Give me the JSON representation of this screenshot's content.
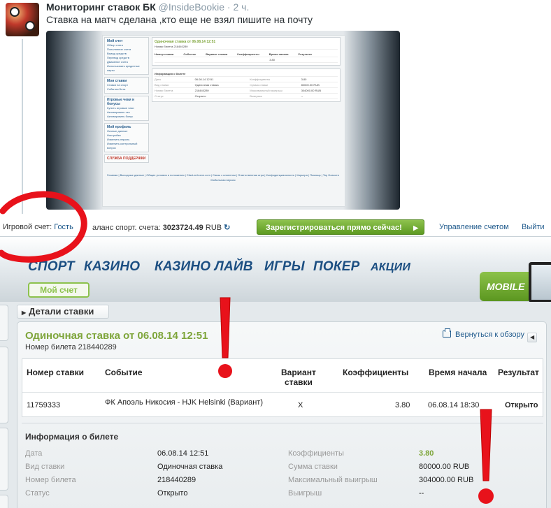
{
  "tweet": {
    "name": "Мониторинг ставок БК",
    "handle": "@InsideBookie",
    "time": "· 2 ч.",
    "text": "Ставка на матч сделана ,кто еще не взял пишите на почту"
  },
  "topbar": {
    "account_label": "Игровой счет:",
    "account_value": "Гость",
    "balance_label": "аланс спорт. счета:",
    "balance_value": "3023724.49",
    "currency": "RUB",
    "register_button": "Зарегистрироваться прямо сейчас!",
    "manage_account": "Управление счетом",
    "logout": "Выйти"
  },
  "nav": {
    "tabs": [
      "СПОРТ",
      "КАЗИНО",
      "КАЗИНО ЛАЙВ",
      "ИГРЫ",
      "ПОКЕР",
      "АКЦИИ"
    ],
    "my_account": "Мой счет",
    "mobile": "MOBILE"
  },
  "bet": {
    "section_tab": "Детали ставки",
    "title": "Одиночная ставка от 06.08.14 12:51",
    "ticket_label": "Номер билета",
    "ticket_number": "218440289",
    "back_link": "Вернуться к обзору",
    "headers": {
      "bet_number": "Номер ставки",
      "event": "Событие",
      "variant": "Вариант\nставки",
      "odds": "Коэффициенты",
      "start_time": "Время начала",
      "result": "Результат"
    },
    "row": {
      "bet_number": "11759333",
      "event": "ФК Апоэль Никосия - HJK Helsinki (Вариант)",
      "variant": "X",
      "odds": "3.80",
      "start_time": "06.08.14 18:30",
      "result": "Открыто"
    }
  },
  "ticket_info": {
    "title": "Информация о билете",
    "left": [
      {
        "label": "Дата",
        "value": "06.08.14 12:51"
      },
      {
        "label": "Вид ставки",
        "value": "Одиночная ставка"
      },
      {
        "label": "Номер билета",
        "value": "218440289"
      },
      {
        "label": "Статус",
        "value": "Открыто"
      }
    ],
    "right": [
      {
        "label": "Коэффициенты",
        "value": "3.80"
      },
      {
        "label": "Сумма ставки",
        "value": "80000.00 RUB"
      },
      {
        "label": "Максимальный выигрыш",
        "value": "304000.00 RUB"
      },
      {
        "label": "Выигрыш",
        "value": "--"
      }
    ]
  },
  "photo_preview": {
    "side_menu": [
      {
        "title": "Мой счет",
        "items": [
          "Обзор счета",
          "Пополнение счета",
          "Вывод средств",
          "Перевод средств",
          "Движение счета",
          "Использовать кредитные карты"
        ]
      },
      {
        "title": "Мои ставки",
        "items": [
          "Ставки на спорт",
          "События Бета"
        ]
      },
      {
        "title": "Игровые чеки и бонусы",
        "items": [
          "Купить игровые чеки",
          "Активировать чек",
          "Активировать бонус"
        ]
      },
      {
        "title": "Мой профиль",
        "items": [
          "Личные данные",
          "Настройки",
          "Изменить пароль",
          "Изменить контрольный вопрос"
        ]
      }
    ],
    "support": "СЛУЖБА ПОДДЕРЖКИ",
    "title": "Одиночная ставка от 06.08.14 12:51",
    "ticket": "Номер билета 218440289",
    "headers": [
      "Номер ставки",
      "Событие",
      "Вариант ставки",
      "Коэффициенты",
      "Время начала",
      "Результат"
    ],
    "row": [
      "3.80"
    ],
    "info_title": "Информация о билете",
    "info_rows": [
      [
        "Дата",
        "06.08.14 12:51",
        "Коэффициенты",
        "3.80"
      ],
      [
        "Вид ставки",
        "Одиночная ставка",
        "Сумма ставки",
        "80000.00 RUB"
      ],
      [
        "Номер билета",
        "218440289",
        "Максимальный выигрыш",
        "304000.00 RUB"
      ],
      [
        "Статус",
        "Открыто",
        "Выигрыш",
        "--"
      ]
    ],
    "footer": [
      "Главная | Выходные данные | Общие условия и положения | Cfaxt-at-home.com | Связь с клиентом | Ответственная игра | Конфиденциальность | Карьера | Помощь | Top Новости",
      "Мобильная версия"
    ]
  },
  "colors": {
    "brand_blue": "#1c4f82",
    "accent_green": "#7ea53a",
    "annotation_red": "#e8121b"
  }
}
